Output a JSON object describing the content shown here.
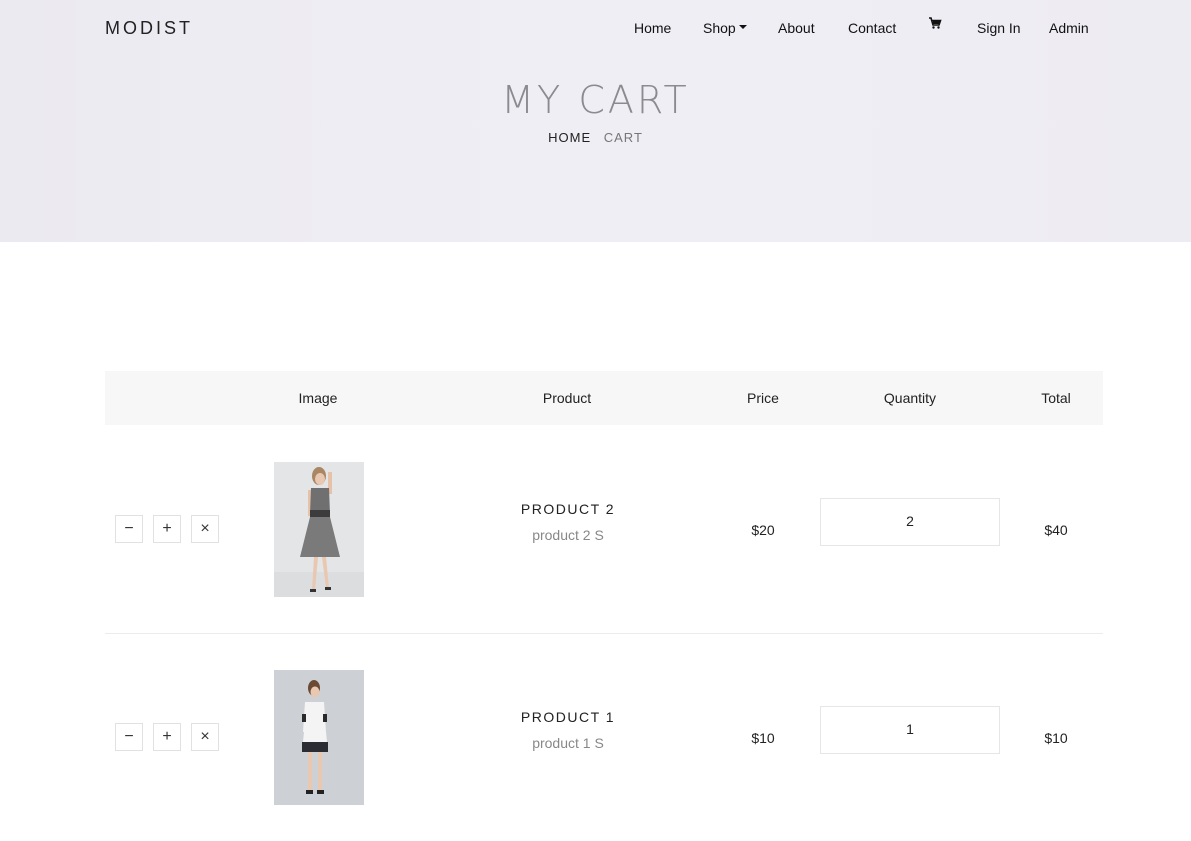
{
  "brand": "MODIST",
  "nav": {
    "home": "Home",
    "shop": "Shop",
    "about": "About",
    "contact": "Contact",
    "cart_icon": "cart-icon",
    "sign_in": "Sign In",
    "admin": "Admin"
  },
  "hero": {
    "title": "MY CART",
    "breadcrumb": {
      "home": "HOME",
      "current": "CART"
    }
  },
  "table": {
    "headers": [
      "Image",
      "Product",
      "Price",
      "Quantity",
      "Total"
    ],
    "rows": [
      {
        "controls": [
          "−",
          "+",
          "×"
        ],
        "name": "PRODUCT 2",
        "variant": "product 2 S",
        "price": "$20",
        "quantity": "2",
        "total": "$40"
      },
      {
        "controls": [
          "−",
          "+",
          "×"
        ],
        "name": "PRODUCT 1",
        "variant": "product 1 S",
        "price": "$10",
        "quantity": "1",
        "total": "$10"
      }
    ]
  },
  "colors": {
    "hero_bg": "#eeedf3",
    "table_head_bg": "#f7f7f7",
    "text": "#222222",
    "muted": "#888888"
  }
}
